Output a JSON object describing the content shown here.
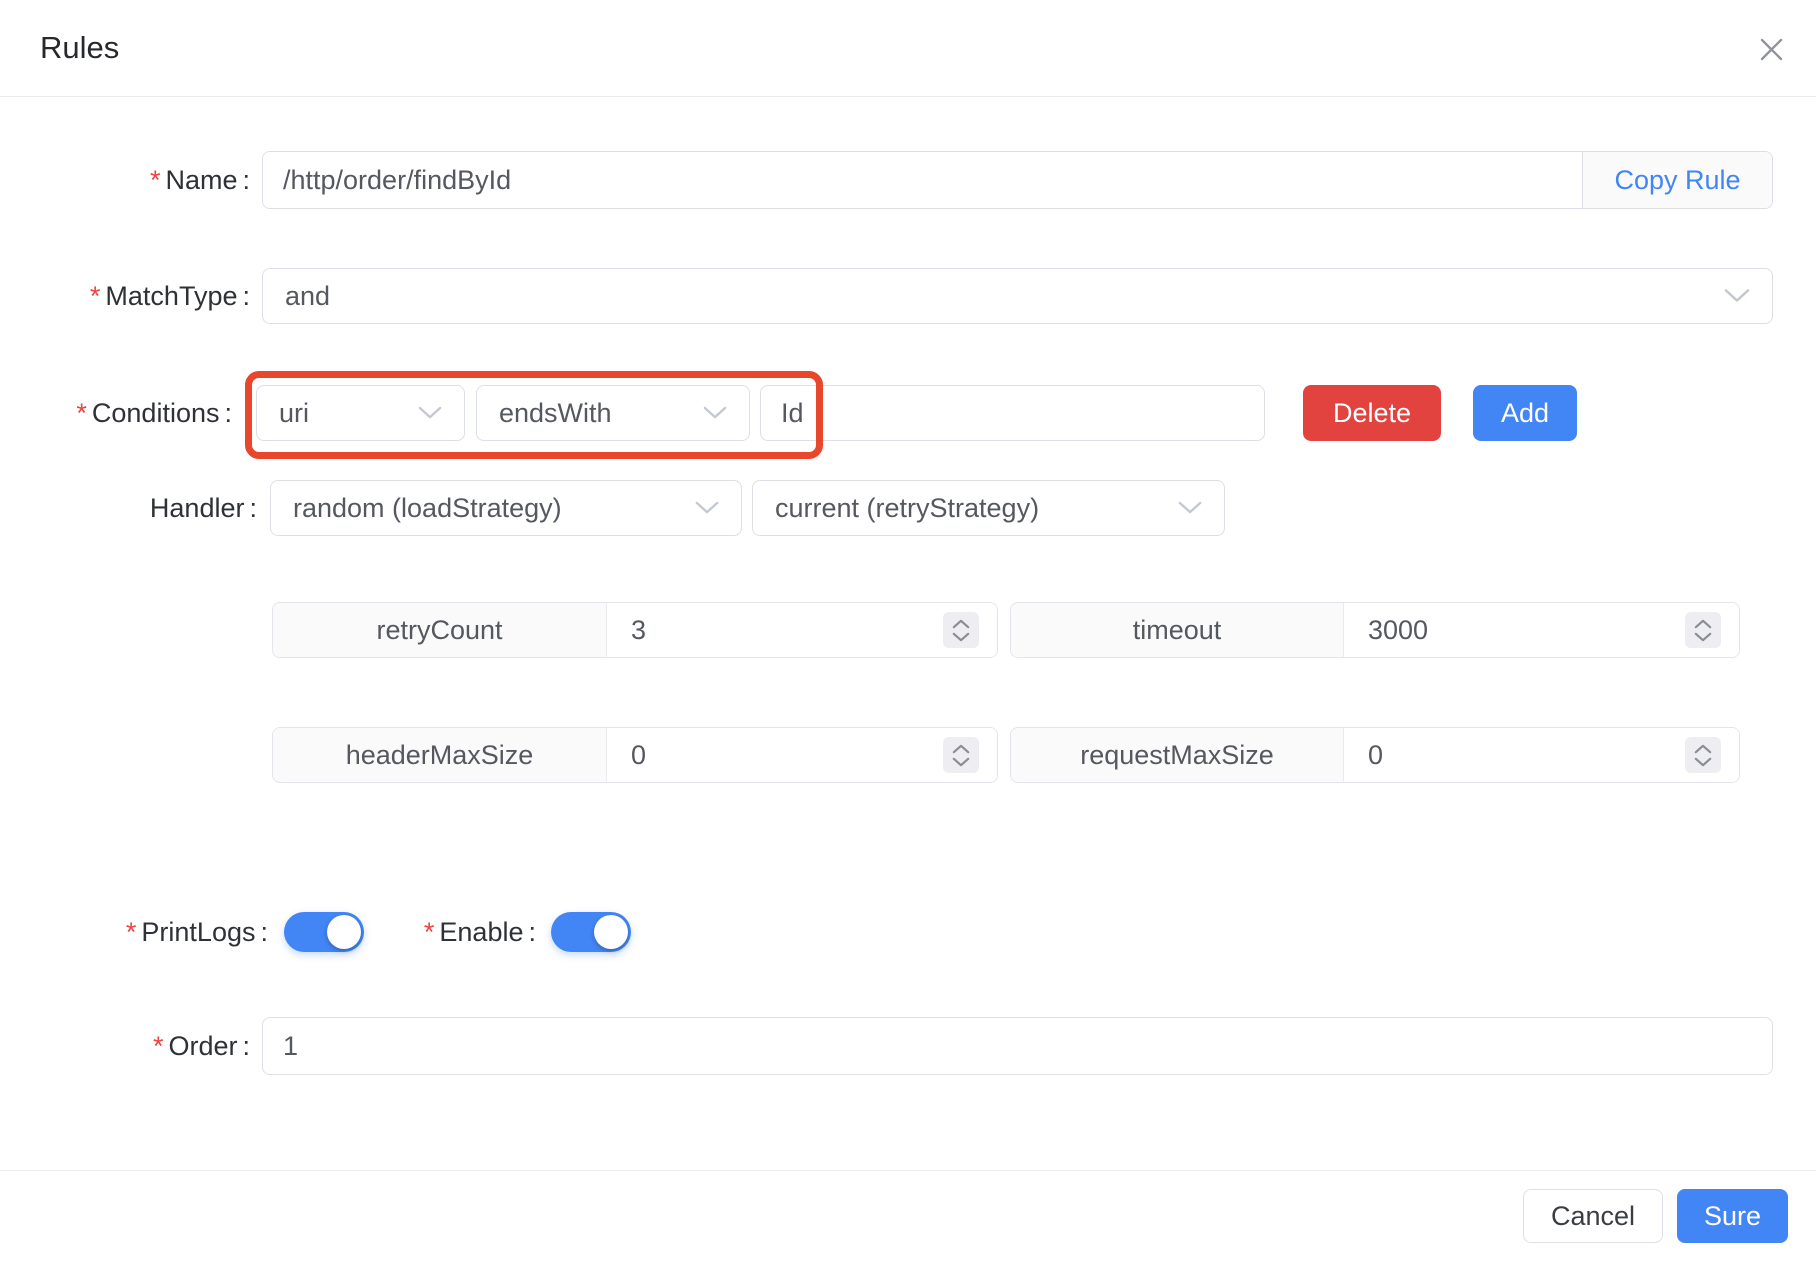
{
  "dialog": {
    "title": "Rules"
  },
  "marks": {
    "required": "*",
    "colon": ":"
  },
  "form": {
    "name": {
      "label": "Name",
      "value": "/http/order/findById",
      "addon_label": "Copy Rule"
    },
    "match_type": {
      "label": "MatchType",
      "value": "and"
    },
    "conditions": {
      "label": "Conditions",
      "field": "uri",
      "operator": "endsWith",
      "value": "Id",
      "delete_label": "Delete",
      "add_label": "Add"
    },
    "handler": {
      "label": "Handler",
      "load_strategy": "random (loadStrategy)",
      "retry_strategy": "current (retryStrategy)"
    },
    "params": [
      {
        "name": "retryCount",
        "value": "3"
      },
      {
        "name": "timeout",
        "value": "3000"
      },
      {
        "name": "headerMaxSize",
        "value": "0"
      },
      {
        "name": "requestMaxSize",
        "value": "0"
      }
    ],
    "print_logs": {
      "label": "PrintLogs",
      "on": true
    },
    "enable": {
      "label": "Enable",
      "on": true
    },
    "order": {
      "label": "Order",
      "value": "1"
    }
  },
  "footer": {
    "cancel_label": "Cancel",
    "sure_label": "Sure"
  },
  "colors": {
    "primary": "#4285f4",
    "danger": "#e2433f",
    "highlight_box": "#e8472b",
    "required": "#f04141"
  }
}
